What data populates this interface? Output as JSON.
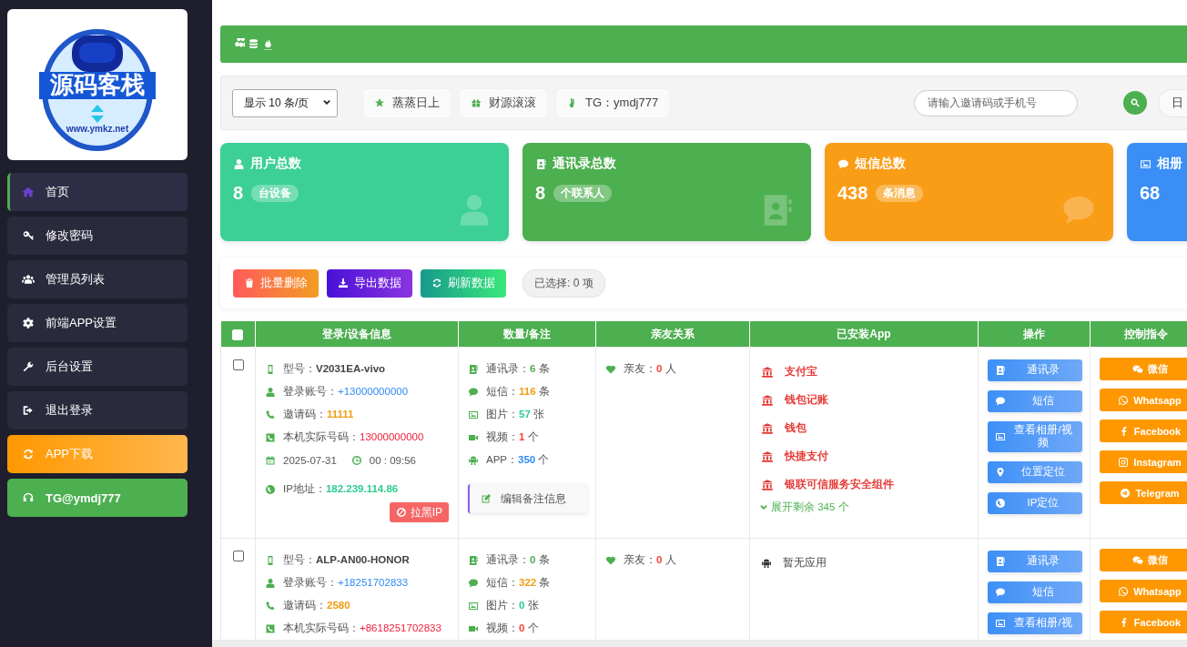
{
  "sidebar": {
    "logo": {
      "title": "源码客栈",
      "url": "www.ymkz.net"
    },
    "items": [
      {
        "label": "首页",
        "kind": "nav",
        "selected": true
      },
      {
        "label": "修改密码",
        "kind": "nav",
        "selected": false
      },
      {
        "label": "管理员列表",
        "kind": "nav",
        "selected": false
      },
      {
        "label": "前端APP设置",
        "kind": "nav",
        "selected": false
      },
      {
        "label": "后台设置",
        "kind": "nav",
        "selected": false
      },
      {
        "label": "退出登录",
        "kind": "nav",
        "selected": false
      },
      {
        "label": "APP下载",
        "kind": "download",
        "selected": false
      },
      {
        "label": "TG@ymdj777",
        "kind": "contact",
        "selected": false
      }
    ]
  },
  "toolbar": {
    "page_size": "显示 10 条/页",
    "tags": [
      "蒸蒸日上",
      "财源滚滚",
      "TG：ymdj777"
    ],
    "search": {
      "placeholder": "请输入邀请码或手机号"
    },
    "date_button": "日"
  },
  "stats": [
    {
      "title": "用户总数",
      "value": "8",
      "unit": "台设备",
      "color": "#3ccf96"
    },
    {
      "title": "通讯录总数",
      "value": "8",
      "unit": "个联系人",
      "color": "#4caf50"
    },
    {
      "title": "短信总数",
      "value": "438",
      "unit": "条消息",
      "color": "#fa9d16"
    },
    {
      "title": "相册",
      "value": "68",
      "color": "#3a8ef6"
    }
  ],
  "actions": {
    "buttons": [
      {
        "label": "批量删除",
        "kind": "delete"
      },
      {
        "label": "导出数据",
        "kind": "export"
      },
      {
        "label": "刷新数据",
        "kind": "refresh"
      }
    ],
    "selection": "已选择: 0 项"
  },
  "table": {
    "select_all": {
      "checked": false
    },
    "columns": [
      "登录/设备信息",
      "数量/备注",
      "亲友关系",
      "已安装App",
      "操作",
      "控制指令"
    ],
    "rows": [
      {
        "checked": false,
        "device": [
          {
            "label": "型号：",
            "value": "V2031EA-vivo",
            "kind": "model"
          },
          {
            "label": "登录账号：",
            "value": "+13000000000",
            "kind": "account"
          },
          {
            "label": "邀请码：",
            "value": "11111",
            "kind": "invite"
          },
          {
            "label": "本机实际号码：",
            "value": "13000000000",
            "kind": "phone"
          }
        ],
        "date": "2025-07-31",
        "time": "00 : 09:56",
        "ip_label": "IP地址：",
        "ip": "182.239.114.86",
        "block_button": "拉黑IP",
        "counts": [
          {
            "label": "通讯录：",
            "value": "6",
            "unit": "条"
          },
          {
            "label": "短信：",
            "value": "116",
            "unit": "条"
          },
          {
            "label": "图片：",
            "value": "57",
            "unit": "张"
          },
          {
            "label": "视频：",
            "value": "1",
            "unit": "个"
          },
          {
            "label": "APP：",
            "value": "350",
            "unit": "个"
          }
        ],
        "note_button": "编辑备注信息",
        "friends": {
          "label": "亲友：",
          "value": "0",
          "unit": "人"
        },
        "apps": [
          {
            "name": "支付宝",
            "kind": "bank"
          },
          {
            "name": "钱包记账",
            "kind": "bank"
          },
          {
            "name": "钱包",
            "kind": "bank"
          },
          {
            "name": "快捷支付",
            "kind": "bank"
          },
          {
            "name": "银联可信服务安全组件",
            "kind": "bank"
          }
        ],
        "expand": "展开剩余 345 个",
        "operations": [
          "通讯录",
          "短信",
          "查看相册/视频",
          "位置定位",
          "IP定位"
        ],
        "commands": [
          "微信",
          "Whatsapp",
          "Facebook",
          "Instagram",
          "Telegram"
        ]
      },
      {
        "checked": false,
        "device": [
          {
            "label": "型号：",
            "value": "ALP-AN00-HONOR",
            "kind": "model"
          },
          {
            "label": "登录账号：",
            "value": "+18251702833",
            "kind": "account"
          },
          {
            "label": "邀请码：",
            "value": "2580",
            "kind": "invite"
          },
          {
            "label": "本机实际号码：",
            "value": "+8618251702833",
            "kind": "phone"
          }
        ],
        "counts": [
          {
            "label": "通讯录：",
            "value": "0",
            "unit": "条"
          },
          {
            "label": "短信：",
            "value": "322",
            "unit": "条"
          },
          {
            "label": "图片：",
            "value": "0",
            "unit": "张"
          },
          {
            "label": "视频：",
            "value": "0",
            "unit": "个"
          }
        ],
        "friends": {
          "label": "亲友：",
          "value": "0",
          "unit": "人"
        },
        "apps": [
          {
            "name": "暂无应用",
            "kind": "android"
          }
        ],
        "operations": [
          "通讯录",
          "短信",
          "查看相册/视"
        ],
        "commands": [
          "微信",
          "Whatsapp",
          "Facebook"
        ]
      }
    ]
  }
}
